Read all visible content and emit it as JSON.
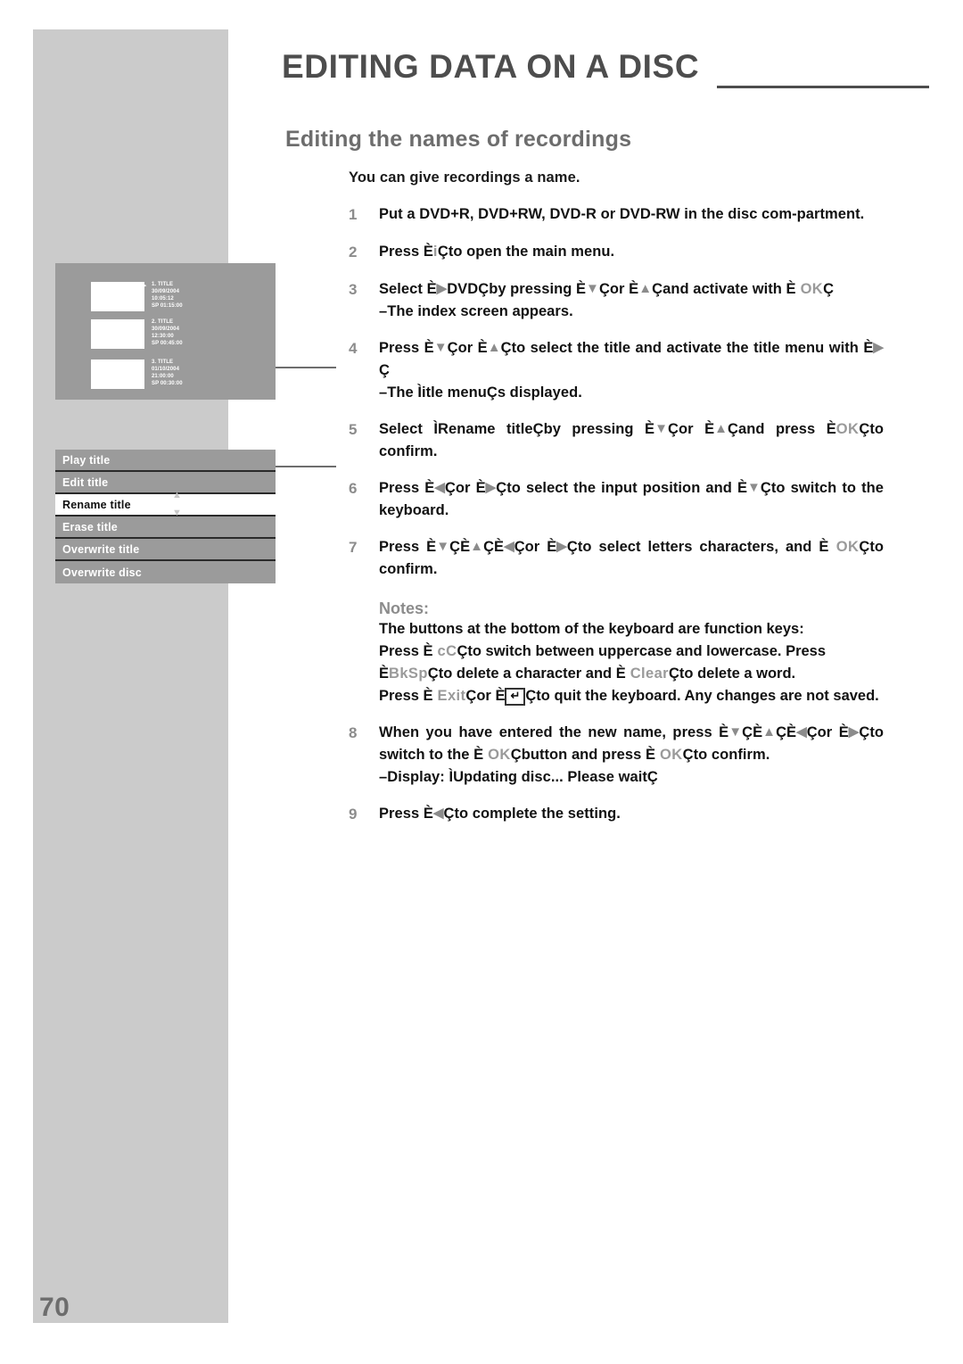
{
  "page": {
    "number": "70",
    "chapter_title": "EDITING DATA ON A DISC",
    "section_title": "Editing the names of recordings",
    "intro": "You can give recordings a name."
  },
  "brackets": {
    "open": "È",
    "close": "Ç"
  },
  "icons": {
    "arrow_down": "▼",
    "arrow_up": "▲",
    "arrow_left": "◀",
    "arrow_right": "▶",
    "return_key": "↵"
  },
  "steps": [
    {
      "num": "1",
      "segments": [
        {
          "t": "Put a DVD+R, DVD+RW, DVD-R or DVD-RW in the disc com-partment.",
          "style": "plain"
        }
      ]
    },
    {
      "num": "2",
      "segments": [
        {
          "t": "Press ",
          "style": "plain"
        },
        {
          "t": "È",
          "style": "bracket"
        },
        {
          "t": "i",
          "style": "key"
        },
        {
          "t": "Ç",
          "style": "bracket"
        },
        {
          "t": "to open the main menu.",
          "style": "plain"
        }
      ]
    },
    {
      "num": "3",
      "segments": [
        {
          "t": "Select ",
          "style": "plain"
        },
        {
          "t": "È",
          "style": "bracket"
        },
        {
          "t": " ▶ ",
          "style": "arrow"
        },
        {
          "t": "DVD",
          "style": "keyblack"
        },
        {
          "t": "Ç",
          "style": "bracket"
        },
        {
          "t": "by pressing ",
          "style": "plain"
        },
        {
          "t": "È",
          "style": "bracket"
        },
        {
          "t": " ▼ ",
          "style": "arrow"
        },
        {
          "t": "Ç",
          "style": "bracket"
        },
        {
          "t": "or ",
          "style": "plain"
        },
        {
          "t": "È",
          "style": "bracket"
        },
        {
          "t": " ▲ ",
          "style": "arrow"
        },
        {
          "t": "Ç",
          "style": "bracket"
        },
        {
          "t": "and activate with ",
          "style": "plain"
        },
        {
          "t": "È",
          "style": "bracket"
        },
        {
          "t": " OK",
          "style": "key"
        },
        {
          "t": "Ç",
          "style": "bracket"
        }
      ],
      "note": "–The index screen appears."
    },
    {
      "num": "4",
      "segments": [
        {
          "t": "Press ",
          "style": "plain"
        },
        {
          "t": "È",
          "style": "bracket"
        },
        {
          "t": " ▼ ",
          "style": "arrow"
        },
        {
          "t": "Ç",
          "style": "bracket"
        },
        {
          "t": "or ",
          "style": "plain"
        },
        {
          "t": "È",
          "style": "bracket"
        },
        {
          "t": " ▲ ",
          "style": "arrow"
        },
        {
          "t": "Ç",
          "style": "bracket"
        },
        {
          "t": "to select the title and activate the title menu with ",
          "style": "plain"
        },
        {
          "t": "È",
          "style": "bracket"
        },
        {
          "t": " ▶ ",
          "style": "arrow"
        },
        {
          "t": "Ç",
          "style": "bracket"
        }
      ],
      "note": "–The Ìitle menuÇs displayed."
    },
    {
      "num": "5",
      "segments": [
        {
          "t": "Select ",
          "style": "plain"
        },
        {
          "t": "Ì",
          "style": "bracket"
        },
        {
          "t": "Rename title",
          "style": "plain"
        },
        {
          "t": "Ç",
          "style": "bracket"
        },
        {
          "t": "by pressing ",
          "style": "plain"
        },
        {
          "t": "È",
          "style": "bracket"
        },
        {
          "t": " ▼ ",
          "style": "arrow"
        },
        {
          "t": "Ç",
          "style": "bracket"
        },
        {
          "t": "or ",
          "style": "plain"
        },
        {
          "t": "È",
          "style": "bracket"
        },
        {
          "t": " ▲ ",
          "style": "arrow"
        },
        {
          "t": "Ç",
          "style": "bracket"
        },
        {
          "t": "and press ",
          "style": "plain"
        },
        {
          "t": "È",
          "style": "bracket"
        },
        {
          "t": "OK",
          "style": "key"
        },
        {
          "t": "Ç",
          "style": "bracket"
        },
        {
          "t": "to confirm.",
          "style": "plain"
        }
      ]
    },
    {
      "num": "6",
      "segments": [
        {
          "t": "Press ",
          "style": "plain"
        },
        {
          "t": "È",
          "style": "bracket"
        },
        {
          "t": " ◀ ",
          "style": "arrow"
        },
        {
          "t": "Ç",
          "style": "bracket"
        },
        {
          "t": "or ",
          "style": "plain"
        },
        {
          "t": "È",
          "style": "bracket"
        },
        {
          "t": " ▶ ",
          "style": "arrow"
        },
        {
          "t": "Ç",
          "style": "bracket"
        },
        {
          "t": "to select the input position and ",
          "style": "plain"
        },
        {
          "t": "È",
          "style": "bracket"
        },
        {
          "t": " ▼ ",
          "style": "arrow"
        },
        {
          "t": "Ç",
          "style": "bracket"
        },
        {
          "t": "to switch to the keyboard.",
          "style": "plain"
        }
      ]
    },
    {
      "num": "7",
      "segments": [
        {
          "t": "Press ",
          "style": "plain"
        },
        {
          "t": "È",
          "style": "bracket"
        },
        {
          "t": " ▼ ",
          "style": "arrow"
        },
        {
          "t": "Ç",
          "style": "bracket"
        },
        {
          "t": "È",
          "style": "bracket"
        },
        {
          "t": " ▲ ",
          "style": "arrow"
        },
        {
          "t": "Ç",
          "style": "bracket"
        },
        {
          "t": "È",
          "style": "bracket"
        },
        {
          "t": " ◀ ",
          "style": "arrow"
        },
        {
          "t": "Ç",
          "style": "bracket"
        },
        {
          "t": "or ",
          "style": "plain"
        },
        {
          "t": "È",
          "style": "bracket"
        },
        {
          "t": " ▶ ",
          "style": "arrow"
        },
        {
          "t": "Ç",
          "style": "bracket"
        },
        {
          "t": "to select letters characters, and ",
          "style": "plain"
        },
        {
          "t": "È",
          "style": "bracket"
        },
        {
          "t": " OK",
          "style": "key"
        },
        {
          "t": "Ç",
          "style": "bracket"
        },
        {
          "t": "to confirm.",
          "style": "plain"
        }
      ]
    },
    {
      "num": "8",
      "segments": [
        {
          "t": "When you have entered the new name, press ",
          "style": "plain"
        },
        {
          "t": "È",
          "style": "bracket"
        },
        {
          "t": " ▼ ",
          "style": "arrow"
        },
        {
          "t": "Ç",
          "style": "bracket"
        },
        {
          "t": "È",
          "style": "bracket"
        },
        {
          "t": " ▲ ",
          "style": "arrow"
        },
        {
          "t": "Ç",
          "style": "bracket"
        },
        {
          "t": "È",
          "style": "bracket"
        },
        {
          "t": " ◀ ",
          "style": "arrow"
        },
        {
          "t": "Ç",
          "style": "bracket"
        },
        {
          "t": "or ",
          "style": "plain"
        },
        {
          "t": "È",
          "style": "bracket"
        },
        {
          "t": " ▶ ",
          "style": "arrow"
        },
        {
          "t": "Ç",
          "style": "bracket"
        },
        {
          "t": "to switch to the ",
          "style": "plain"
        },
        {
          "t": "È",
          "style": "bracket"
        },
        {
          "t": " OK",
          "style": "key"
        },
        {
          "t": "Ç",
          "style": "bracket"
        },
        {
          "t": "button and press ",
          "style": "plain"
        },
        {
          "t": "È",
          "style": "bracket"
        },
        {
          "t": " OK",
          "style": "key"
        },
        {
          "t": "Ç",
          "style": "bracket"
        },
        {
          "t": "to confirm.",
          "style": "plain"
        }
      ],
      "note": "–Display: ÌUpdating disc... Please waitÇ"
    },
    {
      "num": "9",
      "segments": [
        {
          "t": "Press ",
          "style": "plain"
        },
        {
          "t": "È",
          "style": "bracket"
        },
        {
          "t": " ◀ ",
          "style": "arrow"
        },
        {
          "t": "Ç",
          "style": "bracket"
        },
        {
          "t": "to complete the setting.",
          "style": "plain"
        }
      ]
    }
  ],
  "notes": {
    "heading": "Notes:",
    "lines": [
      [
        {
          "t": "The buttons at the bottom of the keyboard are function keys:",
          "style": "plain"
        }
      ],
      [
        {
          "t": "Press ",
          "style": "plain"
        },
        {
          "t": "È",
          "style": "bracket"
        },
        {
          "t": " cC",
          "style": "key"
        },
        {
          "t": "Ç",
          "style": "bracket"
        },
        {
          "t": "to switch between uppercase and lowercase. Press ",
          "style": "plain"
        },
        {
          "t": "È",
          "style": "bracket"
        },
        {
          "t": "BkSp",
          "style": "key"
        },
        {
          "t": "Ç",
          "style": "bracket"
        },
        {
          "t": "to delete a character and ",
          "style": "plain"
        },
        {
          "t": "È",
          "style": "bracket"
        },
        {
          "t": "     Clear",
          "style": "key"
        },
        {
          "t": "Ç",
          "style": "bracket"
        },
        {
          "t": "to delete a word.",
          "style": "plain"
        }
      ],
      [
        {
          "t": "Press ",
          "style": "plain"
        },
        {
          "t": "È",
          "style": "bracket"
        },
        {
          "t": " Exit",
          "style": "key"
        },
        {
          "t": "Ç",
          "style": "bracket"
        },
        {
          "t": "or ",
          "style": "plain"
        },
        {
          "t": "È",
          "style": "bracket"
        },
        {
          "t": "↵",
          "style": "keybox"
        },
        {
          "t": "Ç",
          "style": "bracket"
        },
        {
          "t": "to quit the keyboard. Any changes are not saved.",
          "style": "plain"
        }
      ]
    ]
  },
  "index_screen": {
    "play_marker": "▶",
    "entries": [
      {
        "title": "1. TITLE",
        "date": "30/09/2004",
        "time": "10:05:12",
        "mode": "SP 01:15:00"
      },
      {
        "title": "2. TITLE",
        "date": "30/09/2004",
        "time": "12:30:00",
        "mode": "SP 00:45:00"
      },
      {
        "title": "3. TITLE",
        "date": "01/10/2004",
        "time": "21:00:00",
        "mode": "SP 00:30:00"
      }
    ]
  },
  "title_menu": {
    "items": [
      {
        "label": "Play title",
        "selected": false
      },
      {
        "label": "Edit title",
        "selected": false
      },
      {
        "label": "Rename title",
        "selected": true
      },
      {
        "label": "Erase title",
        "selected": false
      },
      {
        "label": "Overwrite title",
        "selected": false
      },
      {
        "label": "Overwrite disc",
        "selected": false
      }
    ],
    "caret_up": "▲",
    "caret_down": "▼"
  },
  "colors": {
    "band_gray": "#cbcbcb",
    "screen_gray": "#9b9b9b",
    "heading_gray": "#4d4d4d",
    "key_gray": "#9a9a9a"
  }
}
